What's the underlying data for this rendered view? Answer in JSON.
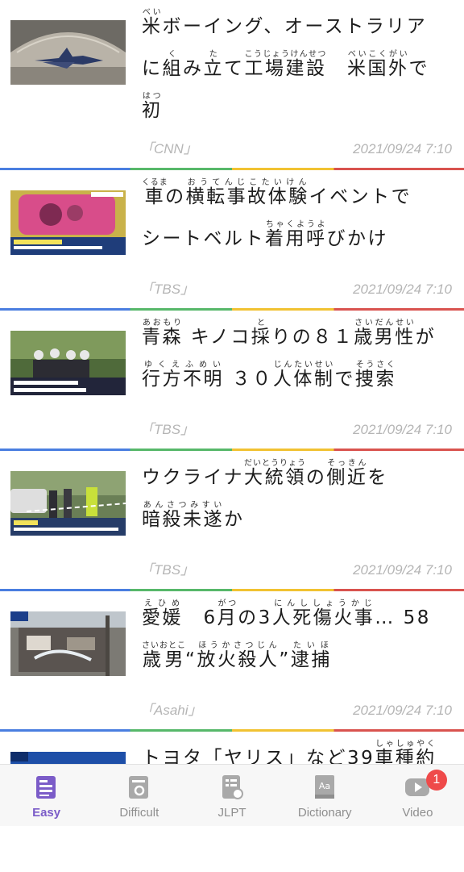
{
  "articles": [
    {
      "lines": [
        [
          {
            "b": "米",
            "r": "べい"
          },
          {
            "t": "ボーイング、オーストラリア"
          }
        ],
        [
          {
            "t": "に"
          },
          {
            "b": "組",
            "r": "く"
          },
          {
            "t": "み"
          },
          {
            "b": "立",
            "r": "た"
          },
          {
            "t": "て"
          },
          {
            "b": "工場建設",
            "r": "こうじょうけんせつ"
          },
          {
            "t": "　"
          },
          {
            "b": "米国外",
            "r": "べいこくがい"
          },
          {
            "t": "で"
          }
        ],
        [
          {
            "b": "初",
            "r": "はつ"
          }
        ]
      ],
      "source": "「CNN」",
      "date": "2021/09/24 7:10"
    },
    {
      "lines": [
        [
          {
            "b": "車",
            "r": "くるま"
          },
          {
            "t": "の"
          },
          {
            "b": "横転事故体験",
            "r": "おうてんじこたいけん"
          },
          {
            "t": "イベントで"
          }
        ],
        [
          {
            "t": "シートベルト"
          },
          {
            "b": "着用呼",
            "r": "ちゃくようよ"
          },
          {
            "t": "びかけ"
          }
        ]
      ],
      "source": "「TBS」",
      "date": "2021/09/24 7:10"
    },
    {
      "lines": [
        [
          {
            "b": "青森",
            "r": "あおもり"
          },
          {
            "t": " キノコ"
          },
          {
            "b": "採",
            "r": "と"
          },
          {
            "t": "りの８１"
          },
          {
            "b": "歳男性",
            "r": "さいだんせい"
          },
          {
            "t": "が"
          }
        ],
        [
          {
            "b": "行方不明",
            "r": "ゆくえふめい"
          },
          {
            "t": " ３０"
          },
          {
            "b": "人体制",
            "r": "じんたいせい"
          },
          {
            "t": "で"
          },
          {
            "b": "捜索",
            "r": "そうさく"
          }
        ]
      ],
      "source": "「TBS」",
      "date": "2021/09/24 7:10"
    },
    {
      "lines": [
        [
          {
            "t": "ウクライナ"
          },
          {
            "b": "大統領",
            "r": "だいとうりょう"
          },
          {
            "t": "の"
          },
          {
            "b": "側近",
            "r": "そっきん"
          },
          {
            "t": "を"
          }
        ],
        [
          {
            "b": "暗殺未遂",
            "r": "あんさつみすい"
          },
          {
            "t": "か"
          }
        ]
      ],
      "source": "「TBS」",
      "date": "2021/09/24 7:10"
    },
    {
      "lines": [
        [
          {
            "b": "愛媛",
            "r": "えひめ"
          },
          {
            "t": "　6"
          },
          {
            "b": "月",
            "r": "がつ"
          },
          {
            "t": "の3"
          },
          {
            "b": "人死傷火事",
            "r": "にんししょうかじ"
          },
          {
            "t": "… 58"
          }
        ],
        [
          {
            "b": "歳男",
            "r": "さいおとこ"
          },
          {
            "t": "“"
          },
          {
            "b": "放火殺人",
            "r": "ほうかさつじん"
          },
          {
            "t": "”"
          },
          {
            "b": "逮捕",
            "r": "たいほ"
          }
        ]
      ],
      "source": "「Asahi」",
      "date": "2021/09/24 7:10"
    },
    {
      "lines": [
        [
          {
            "t": "トヨタ「ヤリス」など39"
          },
          {
            "b": "車種約",
            "r": "しゃしゅやく"
          }
        ]
      ],
      "source": "",
      "date": ""
    }
  ],
  "tabs": [
    {
      "label": "Easy",
      "icon": "easy-doc-icon",
      "active": true
    },
    {
      "label": "Difficult",
      "icon": "difficult-doc-icon",
      "active": false
    },
    {
      "label": "JLPT",
      "icon": "jlpt-doc-icon",
      "active": false
    },
    {
      "label": "Dictionary",
      "icon": "dictionary-book-icon",
      "active": false
    },
    {
      "label": "Video",
      "icon": "video-play-icon",
      "active": false,
      "badge": "1"
    }
  ],
  "colors": {
    "accent": "#7b5cc8",
    "badge": "#ef4a4a",
    "divider": [
      "#4a7ee0",
      "#57b86a",
      "#f1c232",
      "#d9534f"
    ]
  }
}
